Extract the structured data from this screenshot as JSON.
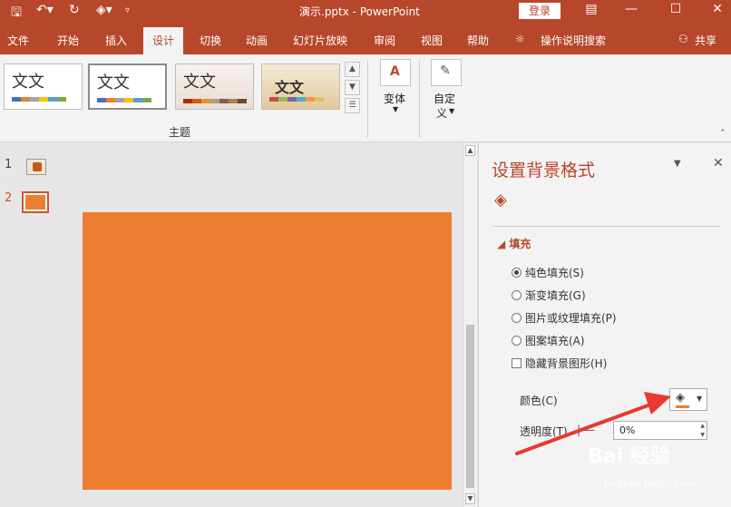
{
  "titlebar": {
    "doc_title": "演示.pptx  -  PowerPoint",
    "login_label": "登录",
    "icons": [
      "save-icon",
      "undo-icon",
      "redo-icon",
      "present-icon",
      "customize-icon"
    ]
  },
  "tabs": [
    "文件",
    "开始",
    "插入",
    "设计",
    "切换",
    "动画",
    "幻灯片放映",
    "审阅",
    "视图",
    "帮助"
  ],
  "tell_me": "操作说明搜索",
  "share": "共享",
  "ribbon": {
    "theme_glyph": "文文",
    "group_label": "主题",
    "variants_label": "变体",
    "customize_label_1": "自定",
    "customize_label_2": "义"
  },
  "slides": {
    "numbers": [
      "1",
      "2"
    ],
    "slide_color": "#ed7d31"
  },
  "pane": {
    "title": "设置背景格式",
    "section": "填充",
    "options": [
      {
        "label": "纯色填充(S)",
        "selected": true
      },
      {
        "label": "渐变填充(G)",
        "selected": false
      },
      {
        "label": "图片或纹理填充(P)",
        "selected": false
      },
      {
        "label": "图案填充(A)",
        "selected": false
      }
    ],
    "hide_bg_label": "隐藏背景图形(H)",
    "color_label": "颜色(C)",
    "transparency_label": "透明度(T)",
    "transparency_value": "0%"
  },
  "watermark": {
    "brand": "Bai  经验",
    "url": "jingyan.baidu.com"
  },
  "colors": {
    "accent": "#b7472a",
    "slide_fill": "#ed7d31",
    "arrow": "#e8392f"
  }
}
